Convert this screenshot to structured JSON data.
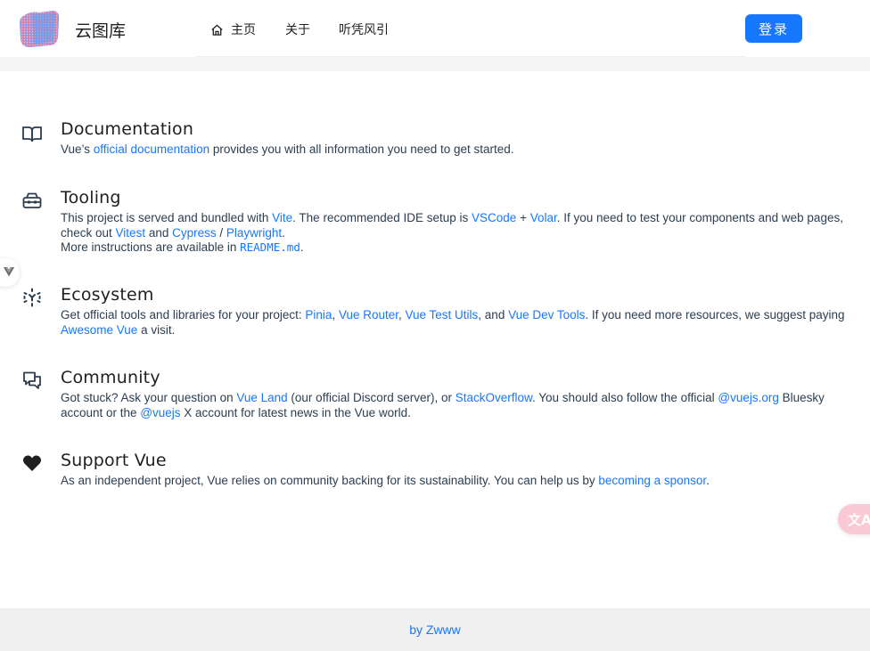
{
  "header": {
    "site_title": "云图库",
    "menu": {
      "home": "主页",
      "about": "关于",
      "tingpingfengyin": "听凭风引"
    },
    "login_label": "登录"
  },
  "sections": {
    "documentation": {
      "title": "Documentation",
      "p1": "Vue’s ",
      "link1": "official documentation",
      "p2": " provides you with all information you need to get started."
    },
    "tooling": {
      "title": "Tooling",
      "p1": "This project is served and bundled with ",
      "link_vite": "Vite",
      "p2": ". The recommended IDE setup is ",
      "link_vscode": "VSCode",
      "p3": " + ",
      "link_volar": "Volar",
      "p4": ". If you need to test your components and web pages, check out ",
      "link_vitest": "Vitest",
      "p5": " and ",
      "link_cypress": "Cypress",
      "p6": " / ",
      "link_playwright": "Playwright",
      "p7": ".",
      "p8": "More instructions are available in ",
      "code_readme": "README.md",
      "p9": "."
    },
    "ecosystem": {
      "title": "Ecosystem",
      "p1": "Get official tools and libraries for your project: ",
      "link_pinia": "Pinia",
      "p2": ", ",
      "link_router": "Vue Router",
      "p3": ", ",
      "link_testutils": "Vue Test Utils",
      "p4": ", and ",
      "link_devtools": "Vue Dev Tools",
      "p5": ". If you need more resources, we suggest paying ",
      "link_awesome": "Awesome Vue",
      "p6": " a visit."
    },
    "community": {
      "title": "Community",
      "p1": "Got stuck? Ask your question on ",
      "link_vueland": "Vue Land",
      "p2": " (our official Discord server), or ",
      "link_stackoverflow": "StackOverflow",
      "p3": ". You should also follow the official ",
      "link_bluesky": "@vuejs.org",
      "p4": " Bluesky account or the ",
      "link_x": "@vuejs",
      "p5": " X account for latest news in the Vue world."
    },
    "support": {
      "title": "Support Vue",
      "p1": "As an independent project, Vue relies on community backing for its sustainability. You can help us by ",
      "link_sponsor": "becoming a sponsor",
      "p2": "."
    }
  },
  "translate_button": "文A",
  "footer": {
    "credit": "by Zwww"
  },
  "colors": {
    "accent": "#1677ff",
    "text": "#2c3e50",
    "footer_bg": "#f0f0f0"
  }
}
